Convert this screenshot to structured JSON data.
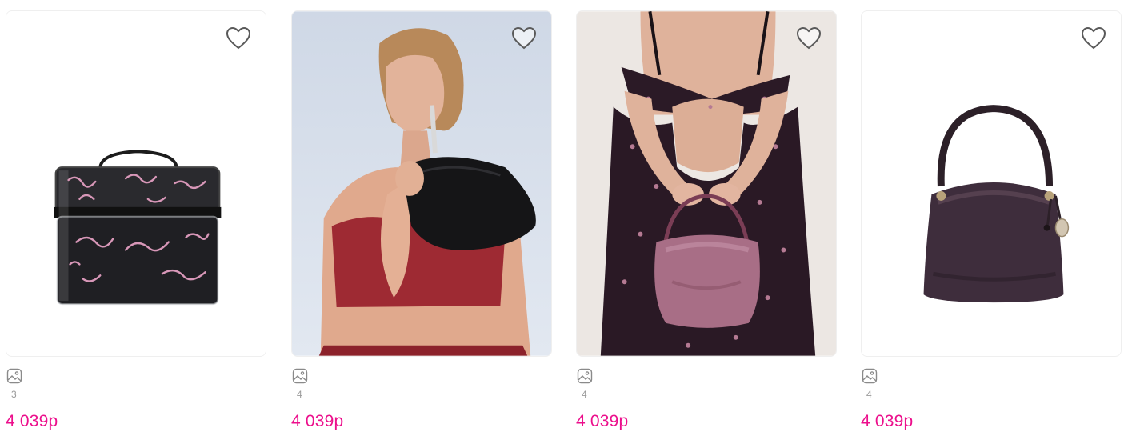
{
  "colors": {
    "price": "#ec0f8c",
    "muted": "#9a9a9a",
    "icon_stroke": "#5a5a5a"
  },
  "products": [
    {
      "image": "clear-travel-train-case",
      "favorite_icon": "heart-outline-icon",
      "gallery_icon": "image-gallery-icon",
      "photo_count": "3",
      "price": "4 039р"
    },
    {
      "image": "model-with-black-sequin-shoulder-bag",
      "favorite_icon": "heart-outline-icon",
      "gallery_icon": "image-gallery-icon",
      "photo_count": "4",
      "price": "4 039р"
    },
    {
      "image": "model-holding-pink-satin-shoulder-bag",
      "favorite_icon": "heart-outline-icon",
      "gallery_icon": "image-gallery-icon",
      "photo_count": "4",
      "price": "4 039р"
    },
    {
      "image": "plum-nylon-hobo-bag",
      "favorite_icon": "heart-outline-icon",
      "gallery_icon": "image-gallery-icon",
      "photo_count": "4",
      "price": "4 039р"
    }
  ]
}
